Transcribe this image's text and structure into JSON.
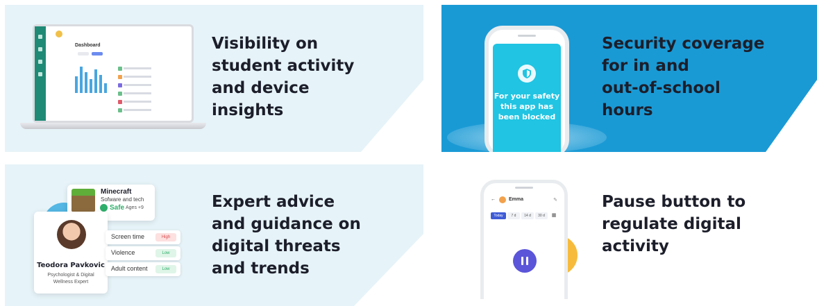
{
  "colors": {
    "light_card_bg": "#e6f3f8",
    "blue_card_bg": "#1a9ad5",
    "phone_screen": "#21c4e2",
    "heading_text": "#1c1e2a",
    "pause_button": "#5b55d9",
    "safe_green": "#2eae6a",
    "sidebar_green": "#1f8a76"
  },
  "cards": [
    {
      "title": "Visibility on\nstudent activity\nand device\ninsights",
      "mockup": {
        "heading": "Dashboard"
      }
    },
    {
      "title": "Security coverage\nfor in and\nout-of-school\nhours",
      "mockup": {
        "message": "For your safety\nthis app has\nbeen blocked",
        "icon": "shield-icon"
      }
    },
    {
      "title": "Expert advice\nand guidance on\ndigital threats\nand trends",
      "mockup": {
        "app_name": "Minecraft",
        "app_category": "Sofware and tech",
        "safety": "Safe",
        "ages": "Ages +9",
        "expert_name": "Teodora Pavkovic",
        "expert_role": "Psychologist & Digital\nWellness Expert",
        "risks": [
          {
            "label": "Screen time",
            "level": "High"
          },
          {
            "label": "Violence",
            "level": "Low"
          },
          {
            "label": "Adult content",
            "level": "Low"
          }
        ]
      }
    },
    {
      "title": "Pause button to\nregulate digital\nactivity",
      "mockup": {
        "child_name": "Emma",
        "tabs": [
          "Today",
          "7 d",
          "14 d",
          "30 d"
        ],
        "icon": "pause-icon"
      }
    }
  ]
}
